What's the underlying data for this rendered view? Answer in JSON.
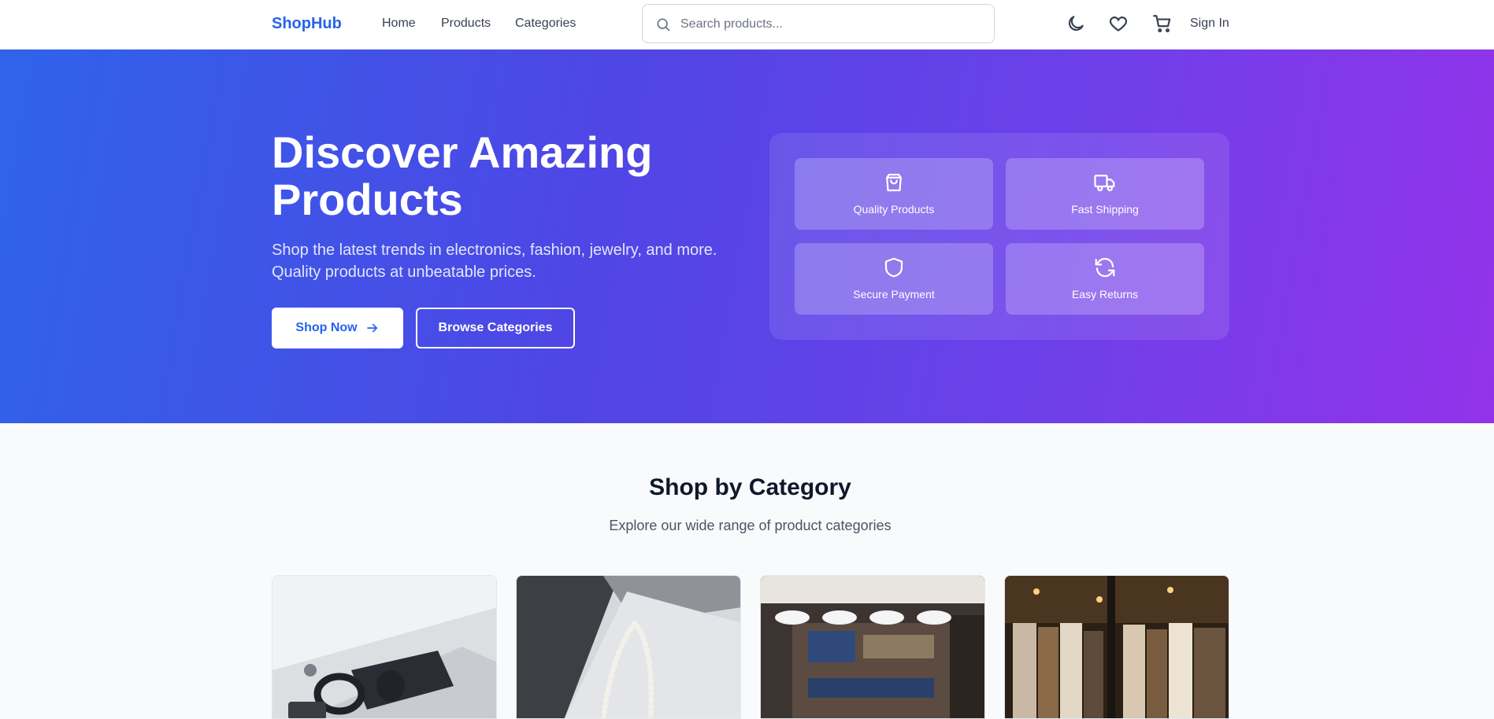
{
  "header": {
    "logo": "ShopHub",
    "nav": [
      {
        "label": "Home"
      },
      {
        "label": "Products"
      },
      {
        "label": "Categories"
      }
    ],
    "search": {
      "placeholder": "Search products..."
    },
    "icons": [
      "moon-icon",
      "heart-icon",
      "cart-icon"
    ],
    "sign_in": "Sign In"
  },
  "hero": {
    "title_line1": "Discover Amazing",
    "title_line2": "Products",
    "subtitle_line1": "Shop the latest trends in electronics, fashion, jewelry, and more.",
    "subtitle_line2": "Quality products at unbeatable prices.",
    "primary_button": "Shop Now",
    "secondary_button": "Browse Categories",
    "features": [
      {
        "label": "Quality Products",
        "icon": "shopping-bag-icon"
      },
      {
        "label": "Fast Shipping",
        "icon": "truck-icon"
      },
      {
        "label": "Secure Payment",
        "icon": "shield-icon"
      },
      {
        "label": "Easy Returns",
        "icon": "refresh-icon"
      }
    ]
  },
  "categories": {
    "title": "Shop by Category",
    "subtitle": "Explore our wide range of product categories",
    "cards": [
      {
        "image": "electronics-image"
      },
      {
        "image": "jewelry-image"
      },
      {
        "image": "store-interior-image"
      },
      {
        "image": "clothing-rack-image"
      }
    ]
  },
  "colors": {
    "brand": "#2563eb",
    "hero_start": "#2f63ea",
    "hero_end": "#9333ea",
    "page_bg": "#f8fafc"
  }
}
